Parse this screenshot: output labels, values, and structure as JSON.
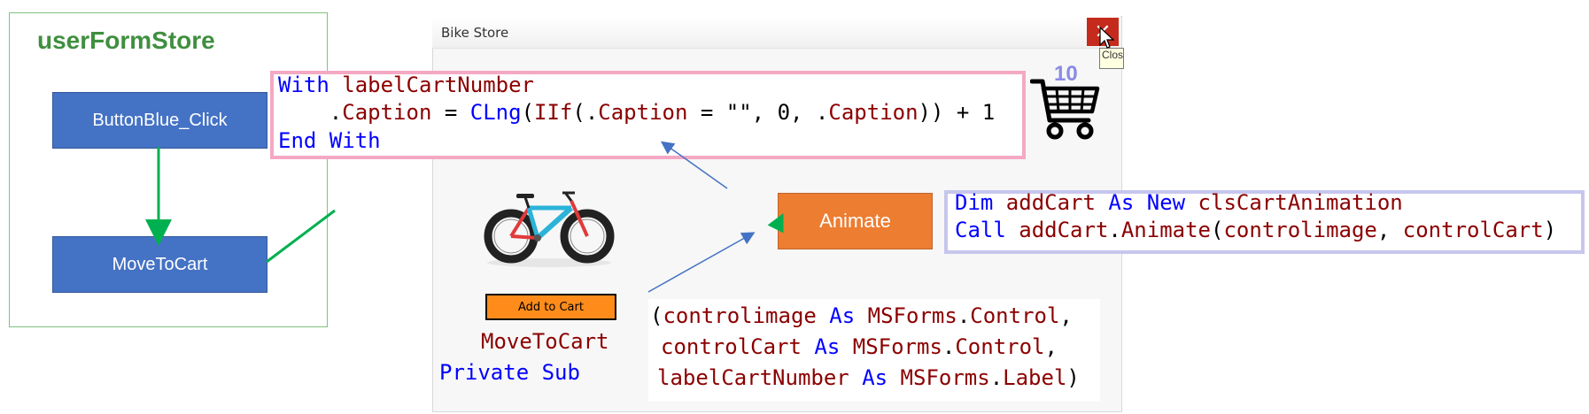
{
  "left_panel": {
    "title": "userFormStore",
    "button_blue_label": "ButtonBlue_Click",
    "move_to_cart_label": "MoveToCart"
  },
  "window": {
    "title": "Bike Store",
    "close_glyph": "✕",
    "close_tooltip": "Close"
  },
  "with_block": {
    "line1": [
      {
        "t": "With ",
        "c": "kw"
      },
      {
        "t": "labelCartNumber",
        "c": "id"
      }
    ],
    "line2": [
      {
        "t": "    .",
        "c": "pn"
      },
      {
        "t": "Caption",
        "c": "id"
      },
      {
        "t": " = ",
        "c": "pn"
      },
      {
        "t": "CLng",
        "c": "kw"
      },
      {
        "t": "(",
        "c": "pn"
      },
      {
        "t": "IIf",
        "c": "id"
      },
      {
        "t": "(.",
        "c": "pn"
      },
      {
        "t": "Caption",
        "c": "id"
      },
      {
        "t": " = \"\", 0, .",
        "c": "pn"
      },
      {
        "t": "Caption",
        "c": "id"
      },
      {
        "t": ")) + 1",
        "c": "pn"
      }
    ],
    "line3": [
      {
        "t": "End With",
        "c": "kw"
      }
    ]
  },
  "cart": {
    "count": "10",
    "icon": "shopping-cart-icon"
  },
  "animate_label": "Animate",
  "dim_block": {
    "line1": [
      {
        "t": "Dim ",
        "c": "kw"
      },
      {
        "t": "addCart ",
        "c": "id"
      },
      {
        "t": "As New ",
        "c": "kw"
      },
      {
        "t": "clsCartAnimation",
        "c": "id"
      }
    ],
    "line2": [
      {
        "t": "Call ",
        "c": "kw"
      },
      {
        "t": "addCart",
        "c": "id"
      },
      {
        "t": ".",
        "c": "pn"
      },
      {
        "t": "Animate",
        "c": "id"
      },
      {
        "t": "(",
        "c": "pn"
      },
      {
        "t": "controlimage",
        "c": "id"
      },
      {
        "t": ", ",
        "c": "pn"
      },
      {
        "t": "controlCart",
        "c": "id"
      },
      {
        "t": ")",
        "c": "pn"
      }
    ]
  },
  "bike_image": "bike-image",
  "add_to_cart_label": "Add to Cart",
  "move_to_cart_text": "MoveToCart",
  "private_sub": [
    {
      "t": "Private Sub",
      "c": "kw"
    }
  ],
  "params": {
    "line1": [
      {
        "t": "(",
        "c": "pn"
      },
      {
        "t": "controlimage ",
        "c": "id"
      },
      {
        "t": "As ",
        "c": "kw"
      },
      {
        "t": "MSForms",
        "c": "id"
      },
      {
        "t": ".",
        "c": "pn"
      },
      {
        "t": "Control",
        "c": "id"
      },
      {
        "t": ",",
        "c": "pn"
      }
    ],
    "line2": [
      {
        "t": "controlCart ",
        "c": "id"
      },
      {
        "t": "As ",
        "c": "kw"
      },
      {
        "t": "MSForms",
        "c": "id"
      },
      {
        "t": ".",
        "c": "pn"
      },
      {
        "t": "Control",
        "c": "id"
      },
      {
        "t": ",",
        "c": "pn"
      }
    ],
    "line3": [
      {
        "t": "labelCartNumber ",
        "c": "id"
      },
      {
        "t": "As ",
        "c": "kw"
      },
      {
        "t": "MSForms",
        "c": "id"
      },
      {
        "t": ".",
        "c": "pn"
      },
      {
        "t": "Label",
        "c": "id"
      },
      {
        "t": ")",
        "c": "pn"
      }
    ]
  },
  "colors": {
    "blue_box": "#4472c4",
    "orange_box": "#ed7d31",
    "green_arrow": "#00b050",
    "keyword": "#0000ff",
    "identifier": "#8b0000",
    "pink_border": "#f4a8c4",
    "lavender_border": "#c6c6ee"
  }
}
